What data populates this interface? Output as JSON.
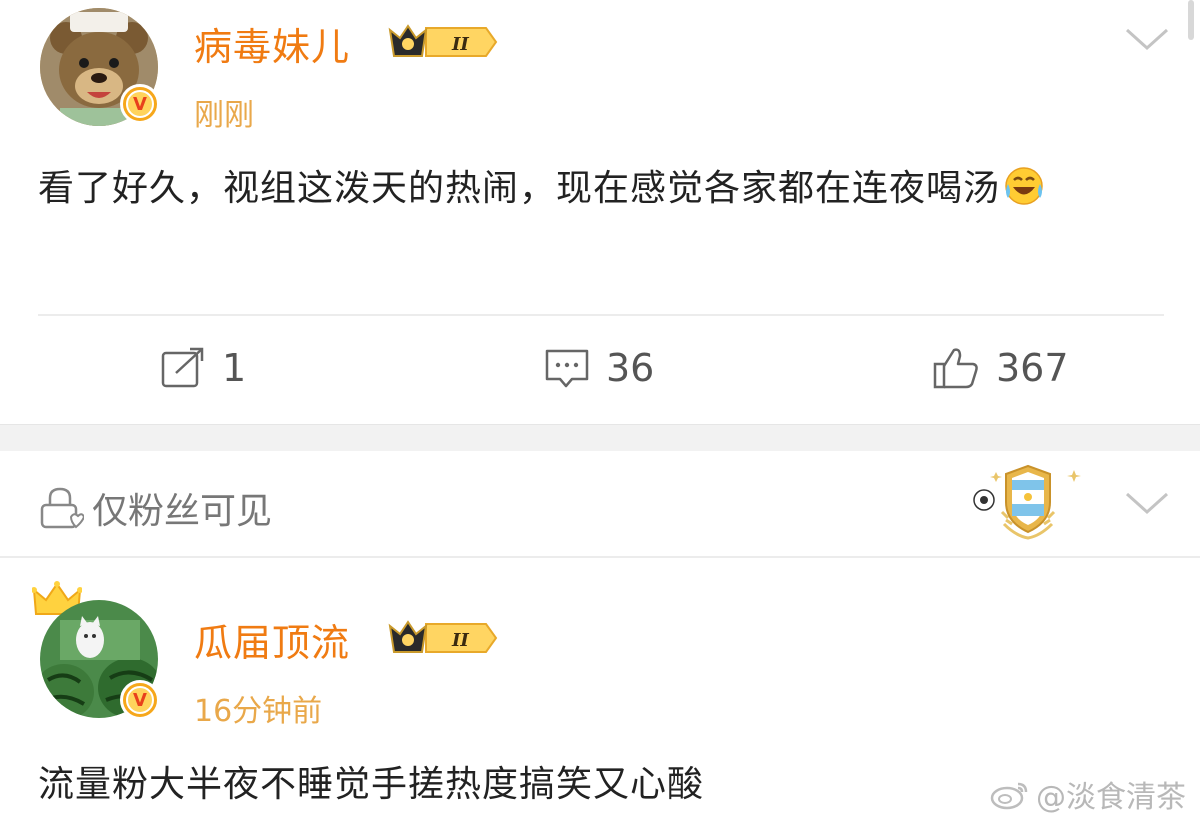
{
  "post1": {
    "username": "病毒妹儿",
    "level": "II",
    "time": "刚刚",
    "text": "看了好久，视组这泼天的热闹，现在感觉各家都在连夜喝汤",
    "actions": {
      "repost": "1",
      "comment": "36",
      "like": "367"
    }
  },
  "post2": {
    "visibility": "仅粉丝可见",
    "username": "瓜届顶流",
    "level": "II",
    "time": "16分钟前",
    "text": "流量粉大半夜不睡觉手搓热度搞笑又心酸"
  },
  "watermark": "@淡食清茶",
  "colors": {
    "username": "#f07b12",
    "time": "#e9a84a",
    "divider": "#ececec",
    "band": "#f2f2f2"
  },
  "icons": [
    "bear-avatar",
    "verified-v-icon",
    "crown-level-badge",
    "chevron-down-icon",
    "repost-icon",
    "comment-icon",
    "like-icon",
    "laughing-tears-emoji-icon",
    "lock-heart-icon",
    "argentina-fan-badge-icon",
    "watermelon-cat-avatar",
    "weibo-logo-icon"
  ]
}
